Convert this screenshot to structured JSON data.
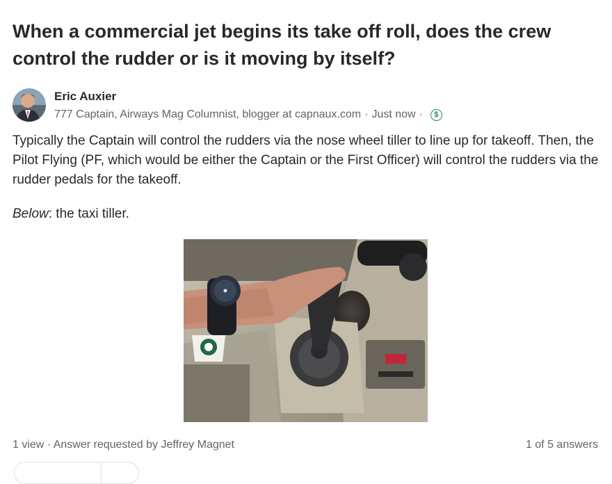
{
  "question": {
    "title": "When a commercial jet begins its take off roll, does the crew control the rudder or is it moving by itself?"
  },
  "author": {
    "name": "Eric Auxier",
    "credential": "777 Captain, Airways Mag Columnist, blogger at capnaux.com",
    "separator": "·",
    "timestamp": "Just now",
    "badge_icon": "dollar-icon"
  },
  "answer": {
    "paragraph": "Typically the Captain will control the rudders via the nose wheel tiller to line up for takeoff. Then, the Pilot Flying (PF, which would be either the Captain or the First Officer) will control the rudders via the rudder pedals for the takeoff.",
    "caption_label": "Below",
    "caption_text": ": the taxi tiller."
  },
  "footer": {
    "views": "1 view",
    "separator": "·",
    "requested": "Answer requested by Jeffrey Magnet",
    "position": "1 of 5 answers"
  }
}
